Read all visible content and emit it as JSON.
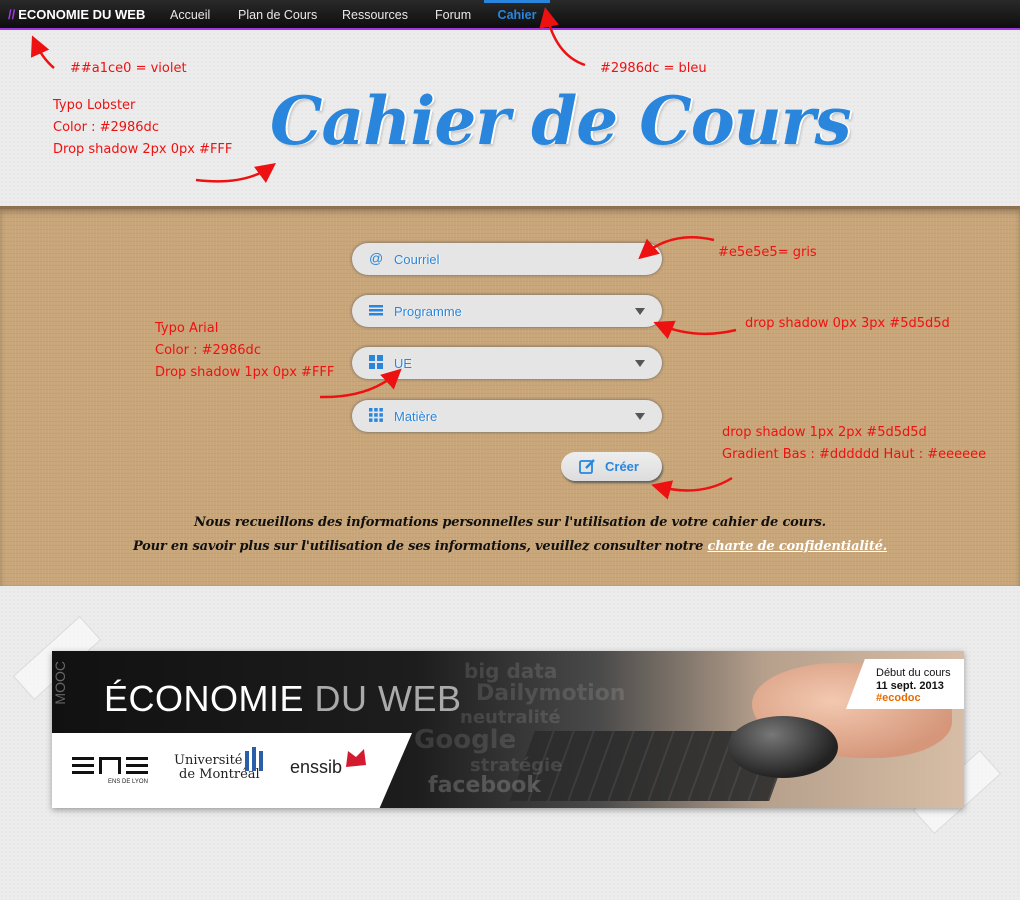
{
  "nav": {
    "brand_prefix": "//",
    "brand": "ECONOMIE DU WEB",
    "items": [
      "Accueil",
      "Plan de Cours",
      "Ressources",
      "Forum",
      "Cahier"
    ],
    "active": "Cahier"
  },
  "header": {
    "title": "Cahier de Cours"
  },
  "form": {
    "fields": [
      {
        "icon": "at-icon",
        "label": "Courriel",
        "dropdown": false
      },
      {
        "icon": "list-icon",
        "label": "Programme",
        "dropdown": true
      },
      {
        "icon": "grid-icon",
        "label": "UE",
        "dropdown": true
      },
      {
        "icon": "dots-grid-icon",
        "label": "Matière",
        "dropdown": true
      }
    ],
    "submit_label": "Créer"
  },
  "notice": {
    "line1": "Nous recueillons des informations personnelles sur l'utilisation de votre cahier de cours.",
    "line2_text": "Pour en savoir plus sur l'utilisation de ses informations, veuillez consulter notre ",
    "line2_link": "charte de confidentialité."
  },
  "annotations": {
    "violet": "##a1ce0 = violet",
    "bleu": "#2986dc = bleu",
    "lobster": "Typo Lobster\nColor : #2986dc\nDrop shadow 2px 0px #FFF",
    "gris": "#e5e5e5= gris",
    "drop_shadow_field": "drop shadow 0px 3px #5d5d5d",
    "arial": "Typo Arial\nColor : #2986dc\nDrop shadow 1px 0px #FFF",
    "button": "drop shadow 1px 2px #5d5d5d\nGradient Bas : #dddddd Haut : #eeeeee"
  },
  "banner": {
    "side_text": "MOOC",
    "title_part1": "ÉCONOMIE ",
    "title_part2": "DU WEB",
    "ghost_words": [
      "big data",
      "Dailymotion",
      "neutralité",
      "Google",
      "stratégie",
      "facebook"
    ],
    "logos": [
      "ENS DE LYON",
      "Université",
      "de Montréal",
      "enssib"
    ],
    "date_label": "Début du cours",
    "date": "11 sept. 2013",
    "hashtag": "#ecodoc"
  },
  "colors": {
    "violet": "#a03ae0",
    "bleu": "#2986dc",
    "gris": "#e5e5e5",
    "annotation": "#ee1111"
  }
}
